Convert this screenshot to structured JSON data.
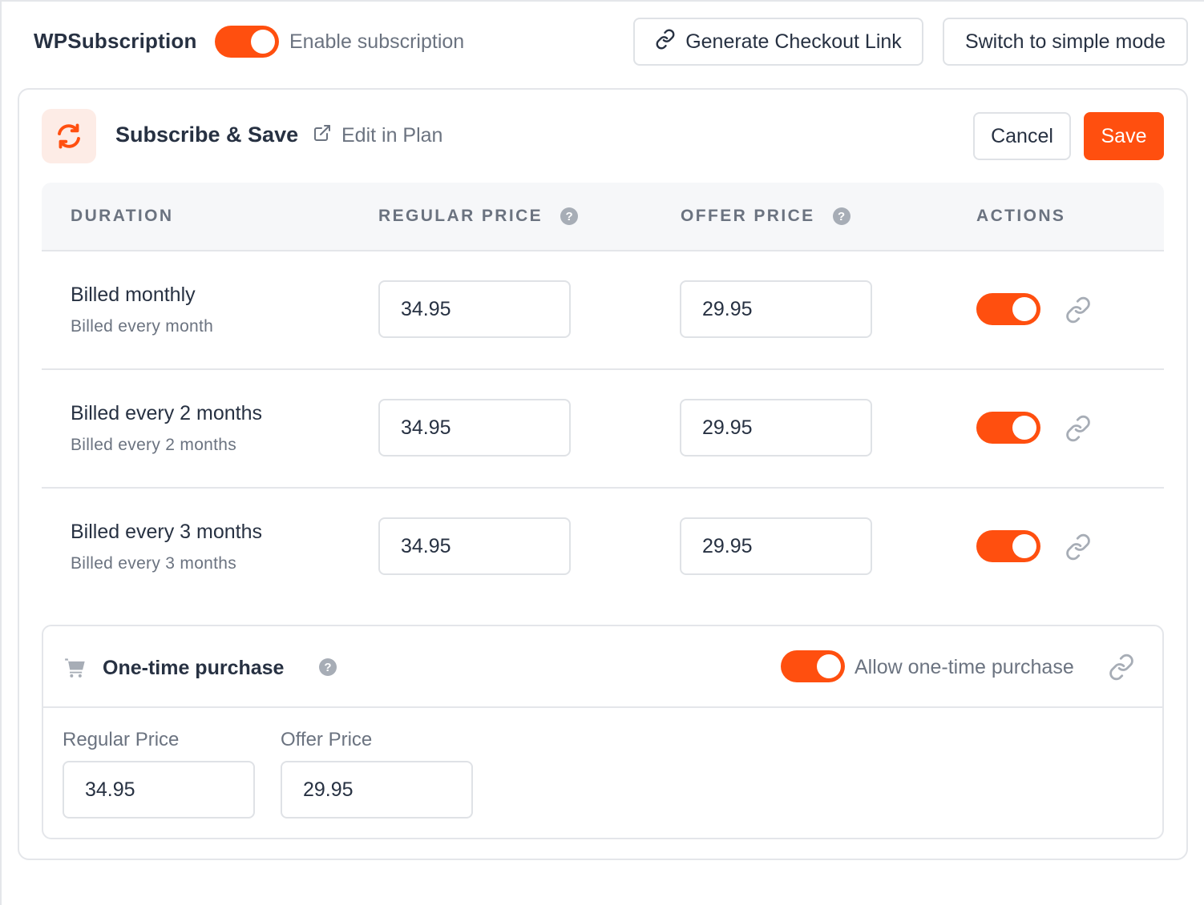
{
  "header": {
    "brand": "WPSubscription",
    "enable_label": "Enable subscription",
    "enable_on": true,
    "checkout_link_label": "Generate Checkout Link",
    "simple_mode_label": "Switch to simple mode"
  },
  "plan": {
    "title": "Subscribe & Save",
    "edit_label": "Edit in Plan",
    "cancel_label": "Cancel",
    "save_label": "Save"
  },
  "table": {
    "headers": {
      "duration": "DURATION",
      "regular": "REGULAR PRICE",
      "offer": "OFFER PRICE",
      "actions": "ACTIONS"
    },
    "rows": [
      {
        "title": "Billed monthly",
        "subtitle": "Billed every month",
        "regular": "34.95",
        "offer": "29.95",
        "enabled": true
      },
      {
        "title": "Billed every 2 months",
        "subtitle": "Billed every 2 months",
        "regular": "34.95",
        "offer": "29.95",
        "enabled": true
      },
      {
        "title": "Billed every 3 months",
        "subtitle": "Billed every 3 months",
        "regular": "34.95",
        "offer": "29.95",
        "enabled": true
      }
    ]
  },
  "one_time": {
    "title": "One-time purchase",
    "allow_label": "Allow one-time purchase",
    "allow_on": true,
    "regular_label": "Regular Price",
    "offer_label": "Offer Price",
    "regular_value": "34.95",
    "offer_value": "29.95"
  },
  "colors": {
    "accent": "#ff4f0f",
    "text": "#273142",
    "muted": "#6b7380",
    "border": "#e4e6ea"
  }
}
